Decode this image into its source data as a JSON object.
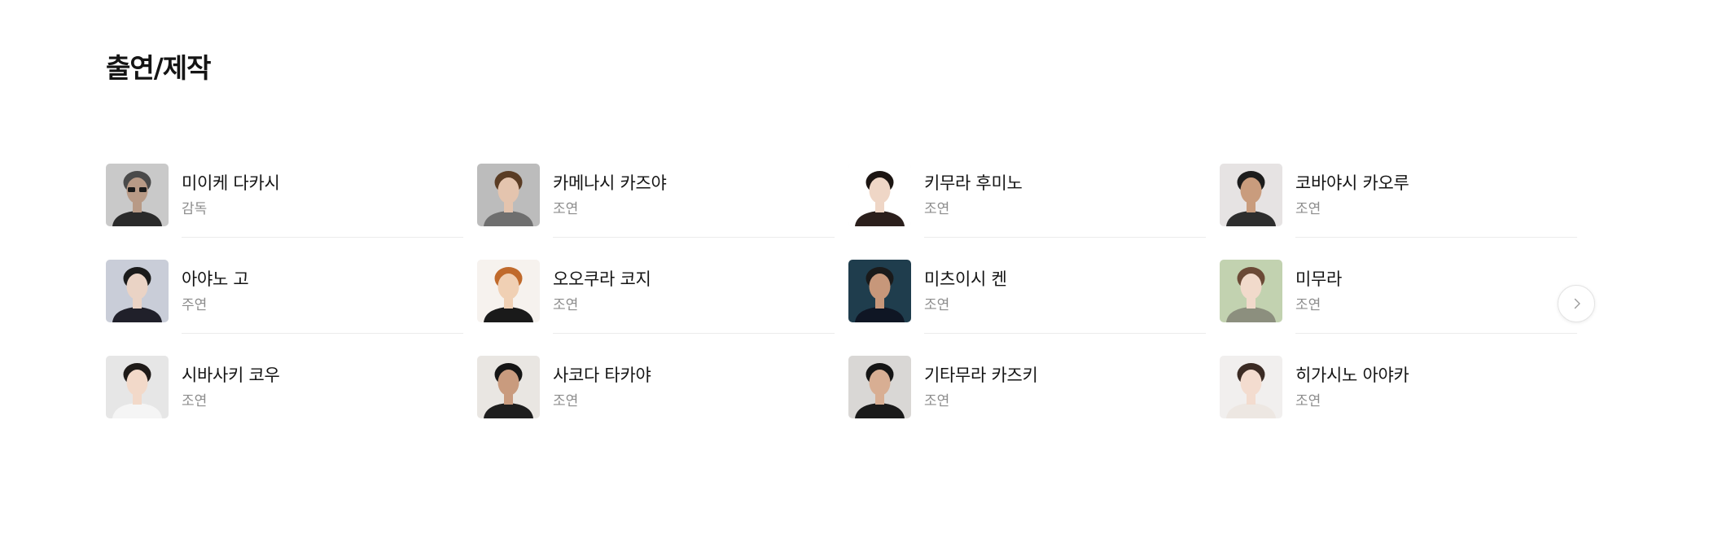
{
  "section": {
    "title": "출연/제작"
  },
  "people": [
    {
      "name": "미이케 다카시",
      "role": "감독",
      "photo": {
        "bg": "#c9c9c9",
        "hair": "#4a4a4a",
        "skin": "#b89a86",
        "shirt": "#2a2a2a",
        "glasses": true
      }
    },
    {
      "name": "카메나시 카즈야",
      "role": "조연",
      "photo": {
        "bg": "#bcbcbc",
        "hair": "#5a3c24",
        "skin": "#e4c4ae",
        "shirt": "#6f6f6f"
      }
    },
    {
      "name": "키무라 후미노",
      "role": "조연",
      "photo": {
        "bg": "#ffffff",
        "hair": "#1c1512",
        "skin": "#efd6c6",
        "shirt": "#2b1f1c"
      }
    },
    {
      "name": "코바야시 카오루",
      "role": "조연",
      "photo": {
        "bg": "#e6e3e3",
        "hair": "#1c1c1c",
        "skin": "#c99c7d",
        "shirt": "#2e2e2e"
      }
    },
    {
      "name": "아야노 고",
      "role": "주연",
      "photo": {
        "bg": "#c9cdd8",
        "hair": "#1b1b1b",
        "skin": "#ead3c5",
        "shirt": "#20202a"
      }
    },
    {
      "name": "오오쿠라 코지",
      "role": "조연",
      "photo": {
        "bg": "#f6f2ee",
        "hair": "#c06a2c",
        "skin": "#f0d0b4",
        "shirt": "#1a1a1a"
      }
    },
    {
      "name": "미츠이시 켄",
      "role": "조연",
      "photo": {
        "bg": "#1f3d4d",
        "hair": "#1a1a1a",
        "skin": "#c7977a",
        "shirt": "#0f1624"
      }
    },
    {
      "name": "미무라",
      "role": "조연",
      "photo": {
        "bg": "#c2d2b0",
        "hair": "#6b4a36",
        "skin": "#f1dacb",
        "shirt": "#8c8f7e"
      }
    },
    {
      "name": "시바사키 코우",
      "role": "조연",
      "photo": {
        "bg": "#e6e6e6",
        "hair": "#1e1a18",
        "skin": "#f2d9c9",
        "shirt": "#f5f5f5"
      }
    },
    {
      "name": "사코다 타카야",
      "role": "조연",
      "photo": {
        "bg": "#e9e6e2",
        "hair": "#151515",
        "skin": "#c99b7e",
        "shirt": "#1e1e1e"
      }
    },
    {
      "name": "기타무라 카즈키",
      "role": "조연",
      "photo": {
        "bg": "#d9d7d5",
        "hair": "#141414",
        "skin": "#d8ae93",
        "shirt": "#1a1a1a"
      }
    },
    {
      "name": "히가시노 아야카",
      "role": "조연",
      "photo": {
        "bg": "#f1efee",
        "hair": "#3b2b24",
        "skin": "#f3dccf",
        "shirt": "#ede7e2"
      }
    }
  ],
  "controls": {
    "next_icon": "chevron-right-icon"
  }
}
